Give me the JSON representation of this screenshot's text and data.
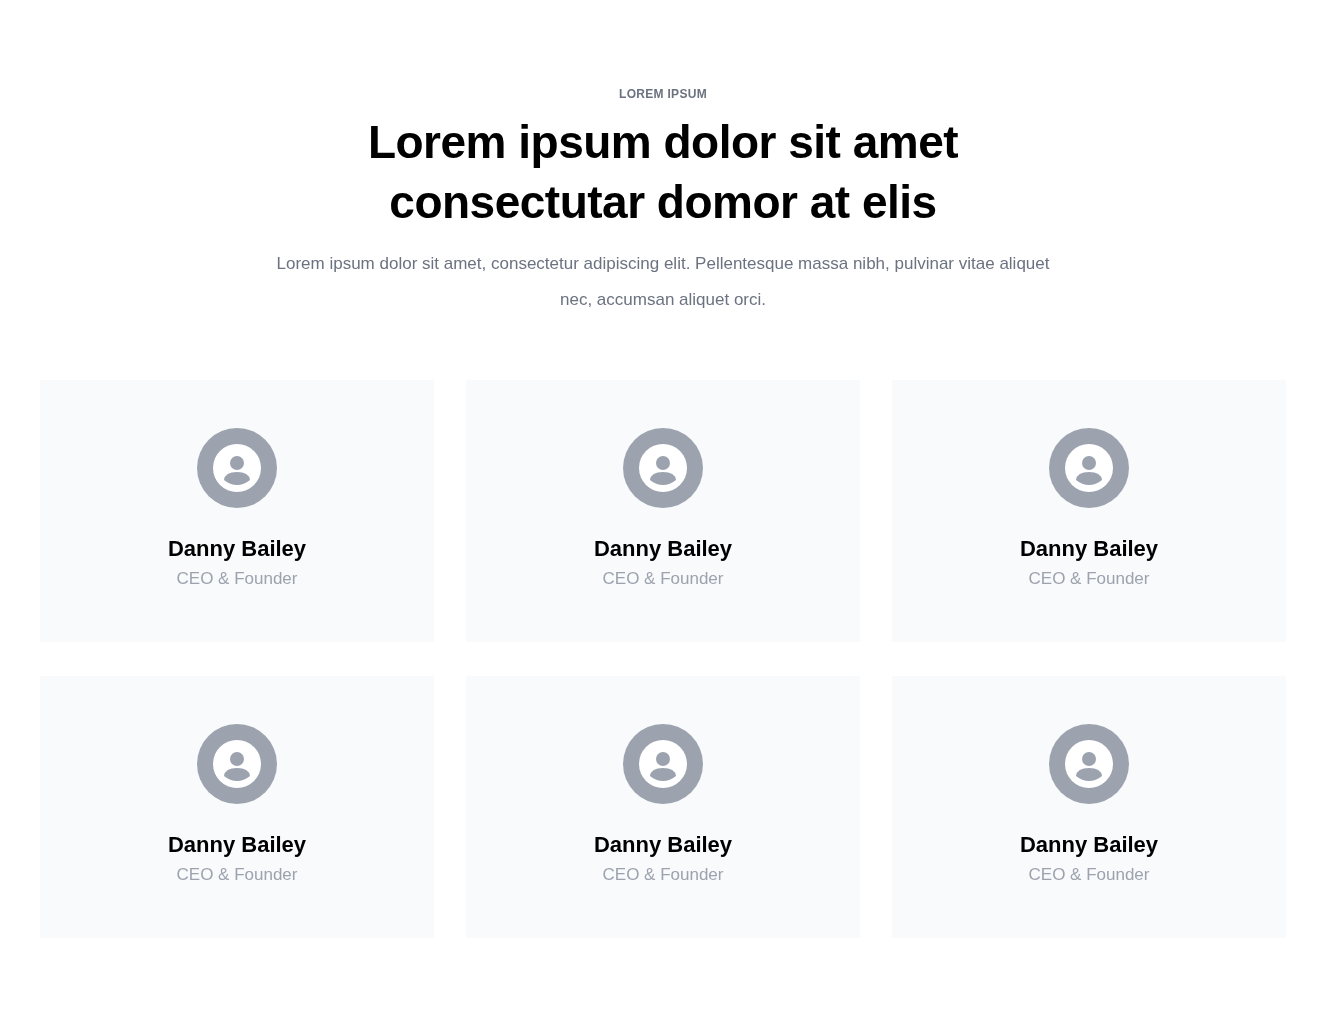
{
  "eyebrow": "LOREM IPSUM",
  "heading_lines": [
    "Lorem ipsum dolor sit amet",
    "consectutar domor at elis"
  ],
  "description": "Lorem ipsum dolor sit amet, consectetur adipiscing elit. Pellentesque massa nibh, pulvinar vitae aliquet nec, accumsan aliquet orci.",
  "team": [
    {
      "name": "Danny Bailey",
      "role": "CEO & Founder"
    },
    {
      "name": "Danny Bailey",
      "role": "CEO & Founder"
    },
    {
      "name": "Danny Bailey",
      "role": "CEO & Founder"
    },
    {
      "name": "Danny Bailey",
      "role": "CEO & Founder"
    },
    {
      "name": "Danny Bailey",
      "role": "CEO & Founder"
    },
    {
      "name": "Danny Bailey",
      "role": "CEO & Founder"
    }
  ]
}
